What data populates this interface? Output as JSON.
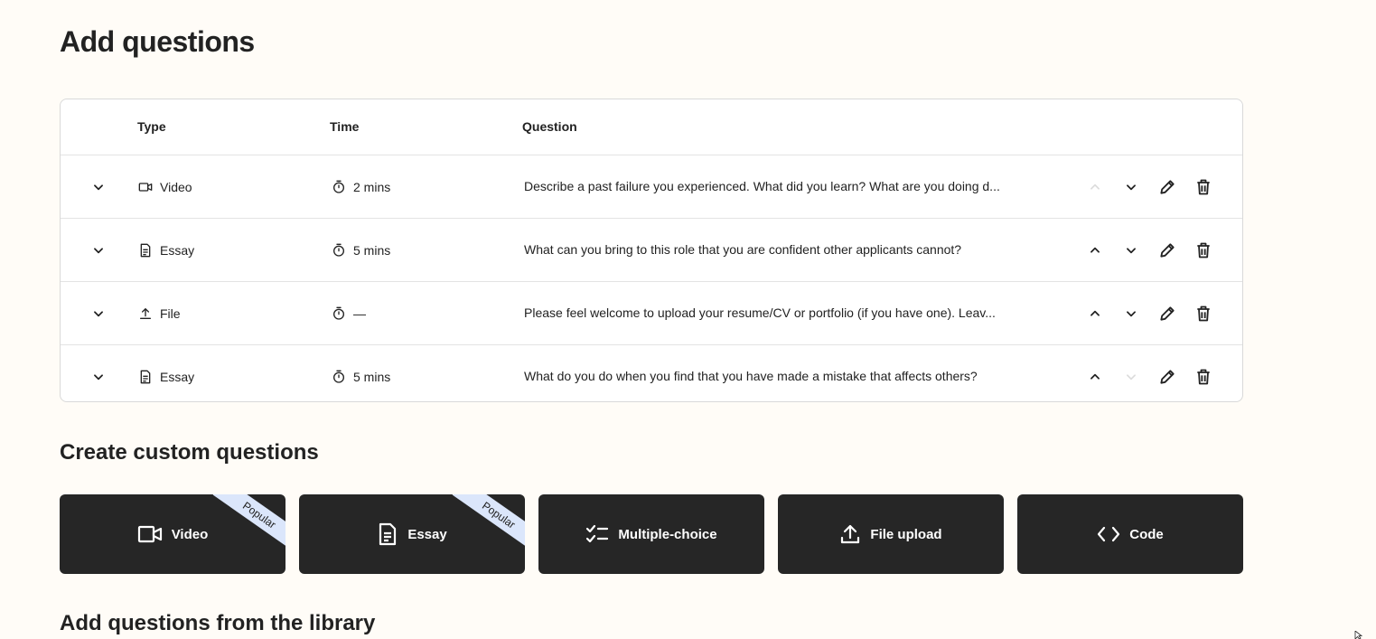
{
  "page": {
    "title": "Add questions"
  },
  "table": {
    "headers": {
      "type": "Type",
      "time": "Time",
      "question": "Question"
    },
    "rows": [
      {
        "type": "Video",
        "type_icon": "video-icon",
        "time": "2 mins",
        "question": "Describe a past failure you experienced. What did you learn? What are you doing d...",
        "up_enabled": false,
        "down_enabled": true
      },
      {
        "type": "Essay",
        "type_icon": "essay-icon",
        "time": "5 mins",
        "question": "What can you bring to this role that you are confident other applicants cannot?",
        "up_enabled": true,
        "down_enabled": true
      },
      {
        "type": "File",
        "type_icon": "upload-icon",
        "time": "—",
        "question": "Please feel welcome to upload your resume/CV or portfolio (if you have one). Leav...",
        "up_enabled": true,
        "down_enabled": true
      },
      {
        "type": "Essay",
        "type_icon": "essay-icon",
        "time": "5 mins",
        "question": "What do you do when you find that you have made a mistake that affects others?",
        "up_enabled": true,
        "down_enabled": false
      }
    ]
  },
  "custom": {
    "title": "Create custom questions",
    "cards": [
      {
        "label": "Video",
        "icon": "video-icon",
        "badge": "Popular"
      },
      {
        "label": "Essay",
        "icon": "essay-icon",
        "badge": "Popular"
      },
      {
        "label": "Multiple-choice",
        "icon": "checklist-icon",
        "badge": ""
      },
      {
        "label": "File upload",
        "icon": "upload-icon",
        "badge": ""
      },
      {
        "label": "Code",
        "icon": "code-icon",
        "badge": ""
      }
    ]
  },
  "library": {
    "title": "Add questions from the library"
  },
  "colors": {
    "background": "#fffcf7",
    "card": "#262626",
    "badge": "#dbe6fb",
    "text": "#222222"
  }
}
